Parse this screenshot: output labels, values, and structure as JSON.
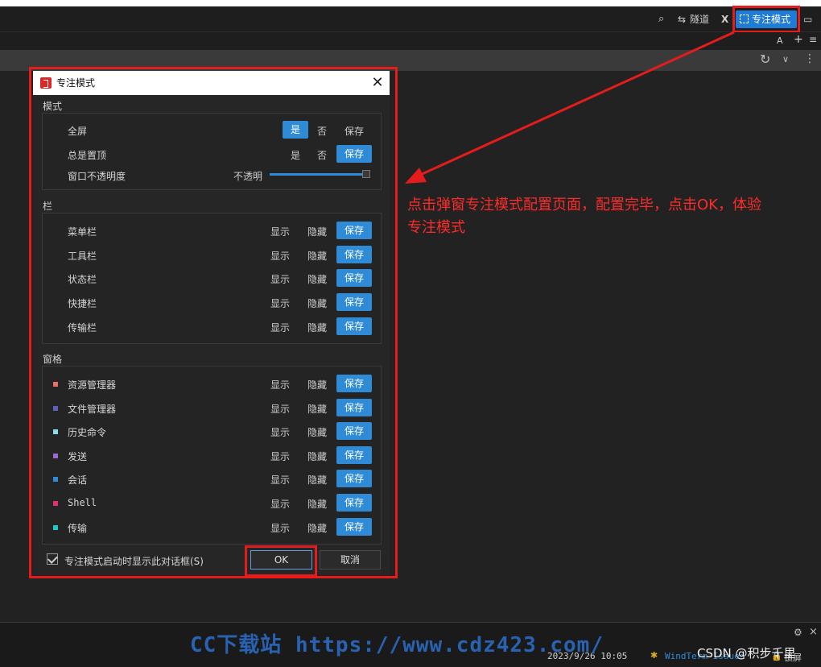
{
  "titlebar": {
    "tunnel_label": "隧道",
    "x_label": "X",
    "focus_mode_label": "专注模式",
    "sub_a": "A",
    "sub_plus": "+",
    "sub_menu": "≡"
  },
  "dialog": {
    "title": "专注模式",
    "sections": {
      "mode": "模式",
      "bars": "栏",
      "panes": "窗格"
    },
    "mode_rows": {
      "fullscreen": {
        "label": "全屏",
        "yes": "是",
        "no": "否",
        "save": "保存"
      },
      "always_on_top": {
        "label": "总是置顶",
        "yes": "是",
        "no": "否",
        "save": "保存"
      },
      "opacity": {
        "label": "窗口不透明度",
        "value_label": "不透明"
      }
    },
    "bar_rows": [
      {
        "label": "菜单栏",
        "show": "显示",
        "hide": "隐藏",
        "save": "保存"
      },
      {
        "label": "工具栏",
        "show": "显示",
        "hide": "隐藏",
        "save": "保存"
      },
      {
        "label": "状态栏",
        "show": "显示",
        "hide": "隐藏",
        "save": "保存"
      },
      {
        "label": "快捷栏",
        "show": "显示",
        "hide": "隐藏",
        "save": "保存"
      },
      {
        "label": "传输栏",
        "show": "显示",
        "hide": "隐藏",
        "save": "保存"
      }
    ],
    "pane_rows": [
      {
        "label": "资源管理器",
        "color": "#e8706a",
        "show": "显示",
        "hide": "隐藏",
        "save": "保存"
      },
      {
        "label": "文件管理器",
        "color": "#5a63b8",
        "show": "显示",
        "hide": "隐藏",
        "save": "保存"
      },
      {
        "label": "历史命令",
        "color": "#8fd6ef",
        "show": "显示",
        "hide": "隐藏",
        "save": "保存"
      },
      {
        "label": "发送",
        "color": "#9a6ad0",
        "show": "显示",
        "hide": "隐藏",
        "save": "保存"
      },
      {
        "label": "会话",
        "color": "#2f8bd6",
        "show": "显示",
        "hide": "隐藏",
        "save": "保存"
      },
      {
        "label": "Shell",
        "color": "#e0307a",
        "show": "显示",
        "hide": "隐藏",
        "save": "保存"
      },
      {
        "label": "传输",
        "color": "#1ec8c8",
        "show": "显示",
        "hide": "隐藏",
        "save": "保存"
      }
    ],
    "show_on_start_label": "专注模式启动时显示此对话框(S)",
    "ok_label": "OK",
    "cancel_label": "取消"
  },
  "annotation": {
    "line1": "点击弹窗专注模式配置页面，配置完毕，点击OK，体验",
    "line2": "专注模式"
  },
  "statusbar": {
    "datetime": "2023/9/26 10:05",
    "issues_label": "WindTerm Issues",
    "lock_label": "锁屏"
  },
  "watermark": {
    "text": "CC下载站 https://www.cdz423.com/",
    "csdn": "CSDN @积步千里"
  }
}
